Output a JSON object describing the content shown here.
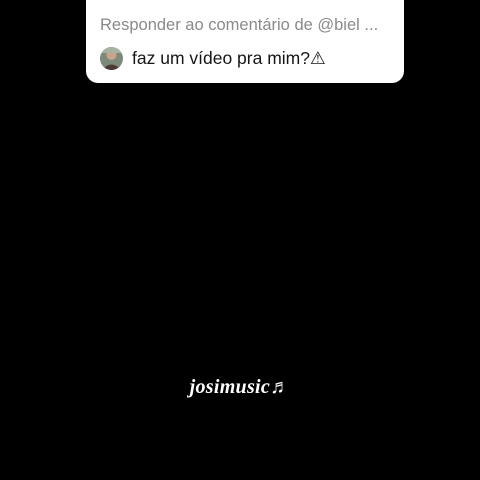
{
  "reply_card": {
    "header": "Responder ao comentário de @biel ...",
    "comment": "faz um vídeo pra mim?⚠"
  },
  "watermark": {
    "text": "josimusic♬"
  }
}
